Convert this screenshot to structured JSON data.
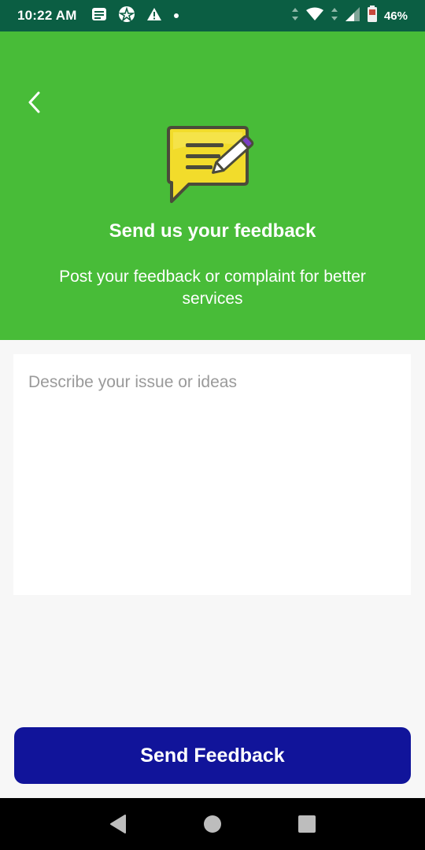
{
  "status_bar": {
    "time": "10:22 AM",
    "battery": "46%"
  },
  "header": {
    "title": "Send us your feedback",
    "subtitle": "Post your feedback or complaint for better services"
  },
  "form": {
    "placeholder": "Describe your issue or ideas",
    "value": ""
  },
  "actions": {
    "send_label": "Send Feedback"
  },
  "colors": {
    "status_bar": "#0b5e43",
    "header": "#48bc38",
    "button": "#11149a",
    "icon_bubble": "#f2dc2b",
    "icon_pencil_tip": "#7b3fc4"
  },
  "icons": {
    "status": [
      "notification-icon",
      "app-icon",
      "warning-icon",
      "dot-icon",
      "data-arrows-icon",
      "wifi-icon",
      "signal-icon",
      "battery-icon"
    ],
    "header": [
      "back-icon",
      "feedback-illustration"
    ],
    "nav": [
      "back-triangle-icon",
      "home-circle-icon",
      "recents-square-icon"
    ]
  }
}
